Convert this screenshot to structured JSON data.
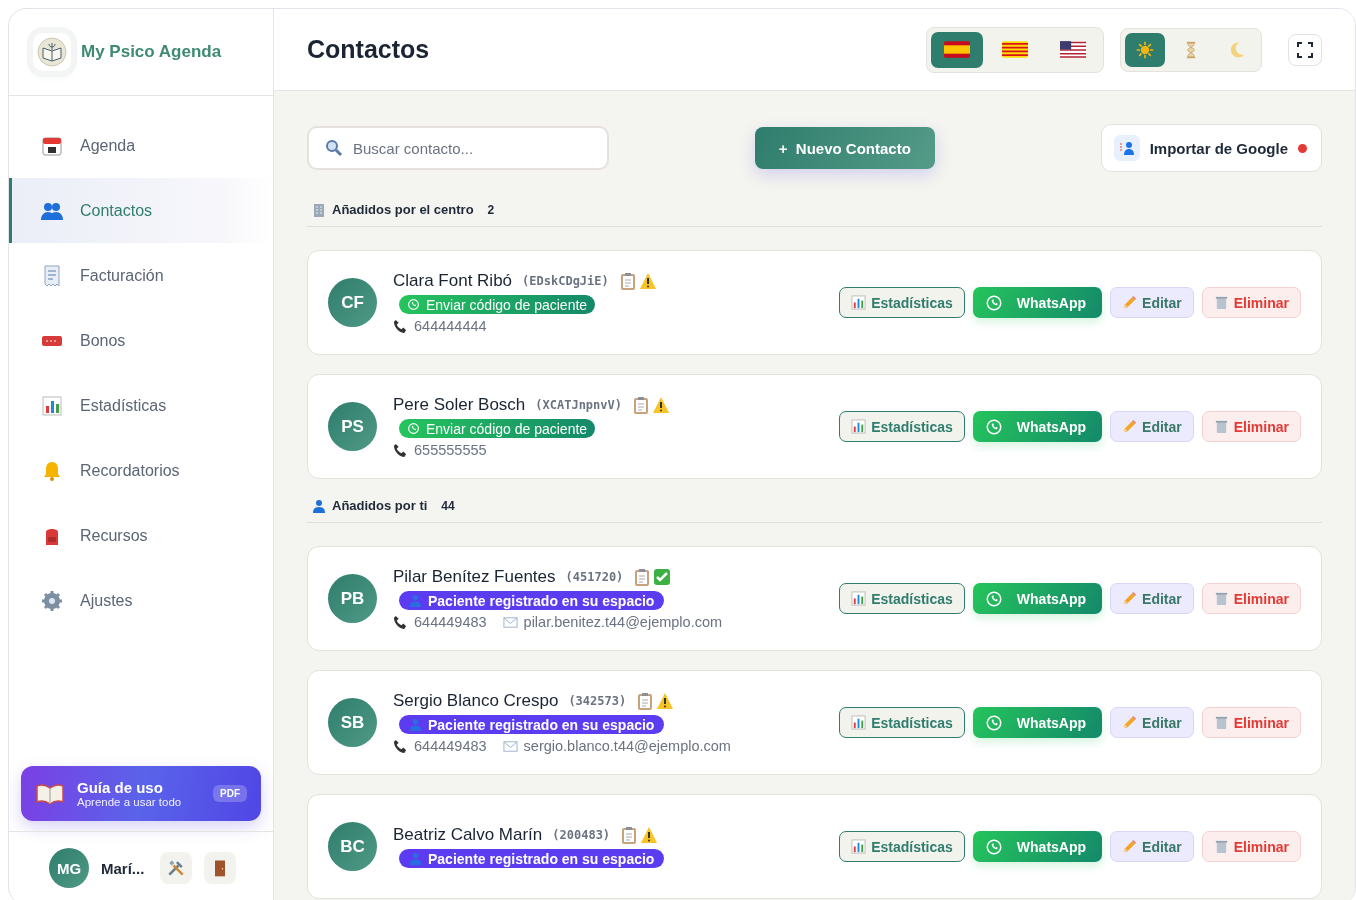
{
  "app": {
    "name": "My Psico Agenda"
  },
  "sidebar": {
    "items": [
      {
        "label": "Agenda",
        "selected": false
      },
      {
        "label": "Contactos",
        "selected": true
      },
      {
        "label": "Facturación",
        "selected": false
      },
      {
        "label": "Bonos",
        "selected": false
      },
      {
        "label": "Estadísticas",
        "selected": false
      },
      {
        "label": "Recordatorios",
        "selected": false
      },
      {
        "label": "Recursos",
        "selected": false
      },
      {
        "label": "Ajustes",
        "selected": false
      }
    ],
    "guide": {
      "title": "Guía de uso",
      "subtitle": "Aprende a usar todo",
      "badge": "PDF"
    },
    "user": {
      "initials": "MG",
      "name": "Marí..."
    }
  },
  "header": {
    "title": "Contactos",
    "languages": [
      {
        "selected": true
      },
      {
        "selected": false
      },
      {
        "selected": false
      }
    ],
    "themes": [
      {
        "selected": true
      },
      {
        "selected": false
      },
      {
        "selected": false
      }
    ]
  },
  "toolbar": {
    "search": {
      "placeholder": "Buscar contacto..."
    },
    "new_button": "+  Nuevo Contacto",
    "import_button": "Importar de Google",
    "import_alert": true
  },
  "sections": [
    {
      "title": "Añadidos por el centro",
      "count": "2",
      "contacts": [
        {
          "initials": "CF",
          "name": "Clara Font Ribó",
          "code": "(EDskCDgJiE)",
          "verified": false,
          "badge": {
            "kind": "whatsapp",
            "label": "Enviar código de paciente"
          },
          "phone": "644444444",
          "actions": [
            "Estadísticas",
            "WhatsApp",
            "Editar",
            "Eliminar"
          ]
        },
        {
          "initials": "PS",
          "name": "Pere Soler Bosch",
          "code": "(XCATJnpnvV)",
          "verified": false,
          "badge": {
            "kind": "whatsapp",
            "label": "Enviar código de paciente"
          },
          "phone": "655555555",
          "actions": [
            "Estadísticas",
            "WhatsApp",
            "Editar",
            "Eliminar"
          ]
        }
      ]
    },
    {
      "title": "Añadidos por ti",
      "count": "44",
      "contacts": [
        {
          "initials": "PB",
          "name": "Pilar Benítez Fuentes",
          "code": "(451720)",
          "verified": true,
          "badge": {
            "kind": "registered",
            "label": "Paciente registrado en su espacio"
          },
          "phone": "644449483",
          "email": "pilar.benitez.t44@ejemplo.com",
          "actions": [
            "Estadísticas",
            "WhatsApp",
            "Editar",
            "Eliminar"
          ]
        },
        {
          "initials": "SB",
          "name": "Sergio Blanco Crespo",
          "code": "(342573)",
          "verified": false,
          "badge": {
            "kind": "registered",
            "label": "Paciente registrado en su espacio"
          },
          "phone": "644449483",
          "email": "sergio.blanco.t44@ejemplo.com",
          "actions": [
            "Estadísticas",
            "WhatsApp",
            "Editar",
            "Eliminar"
          ]
        },
        {
          "initials": "BC",
          "name": "Beatriz Calvo Marín",
          "code": "(200483)",
          "verified": false,
          "badge": {
            "kind": "registered",
            "label": "Paciente registrado en su espacio"
          },
          "actions": [
            "Estadísticas",
            "WhatsApp",
            "Editar",
            "Eliminar"
          ]
        }
      ]
    }
  ]
}
